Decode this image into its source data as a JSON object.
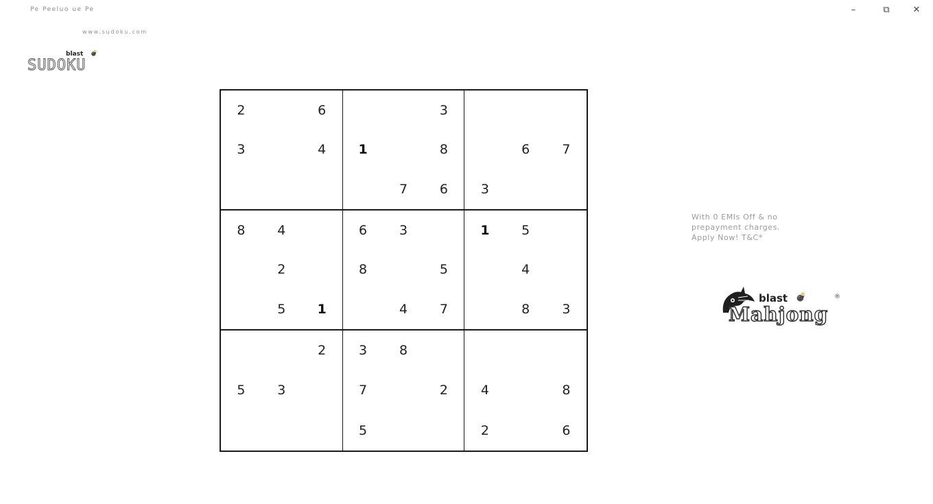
{
  "window": {
    "title": "Pe Peeluo ue Pe",
    "minimize_label": "–",
    "maximize_label": "⧉",
    "close_label": "✕"
  },
  "url": "www.sudoku.com",
  "logo": {
    "top": "blast",
    "bomb": "💣",
    "main": "SUDOKU"
  },
  "board": {
    "boxes": [
      [
        [
          "2",
          "",
          "6"
        ],
        [
          "3",
          "",
          "4"
        ],
        [
          "",
          "",
          ""
        ]
      ],
      [
        [
          "",
          "",
          "3"
        ],
        [
          "1",
          "",
          "8"
        ],
        [
          "",
          "7",
          "6"
        ]
      ],
      [
        [
          "",
          "",
          ""
        ],
        [
          "",
          "6",
          "7"
        ],
        [
          "3",
          "",
          ""
        ]
      ],
      [
        [
          "8",
          "4",
          ""
        ],
        [
          "",
          "2",
          ""
        ],
        [
          "",
          "5",
          "1"
        ]
      ],
      [
        [
          "6",
          "3",
          ""
        ],
        [
          "8",
          "",
          "5"
        ],
        [
          "",
          "4",
          "7"
        ]
      ],
      [
        [
          "1",
          "5",
          ""
        ],
        [
          "",
          "4",
          ""
        ],
        [
          "",
          "8",
          "3"
        ]
      ],
      [
        [
          "",
          "",
          "2"
        ],
        [
          "5",
          "3",
          ""
        ],
        [
          "",
          "",
          ""
        ]
      ],
      [
        [
          "3",
          "8",
          ""
        ],
        [
          "7",
          "",
          "2"
        ],
        [
          "5",
          "",
          ""
        ]
      ],
      [
        [
          "",
          "",
          ""
        ],
        [
          "4",
          "",
          "8"
        ],
        [
          "2",
          "",
          "6"
        ]
      ]
    ],
    "bold_values": [
      "1"
    ]
  },
  "ad": {
    "line1": "With 0 EMIs Off & no",
    "line2": "prepayment charges.",
    "line3": "Apply Now! T&C*",
    "logo_top": "blast",
    "logo_bomb": "💣",
    "logo_main": "Mahjong",
    "logo_tm": "®"
  }
}
